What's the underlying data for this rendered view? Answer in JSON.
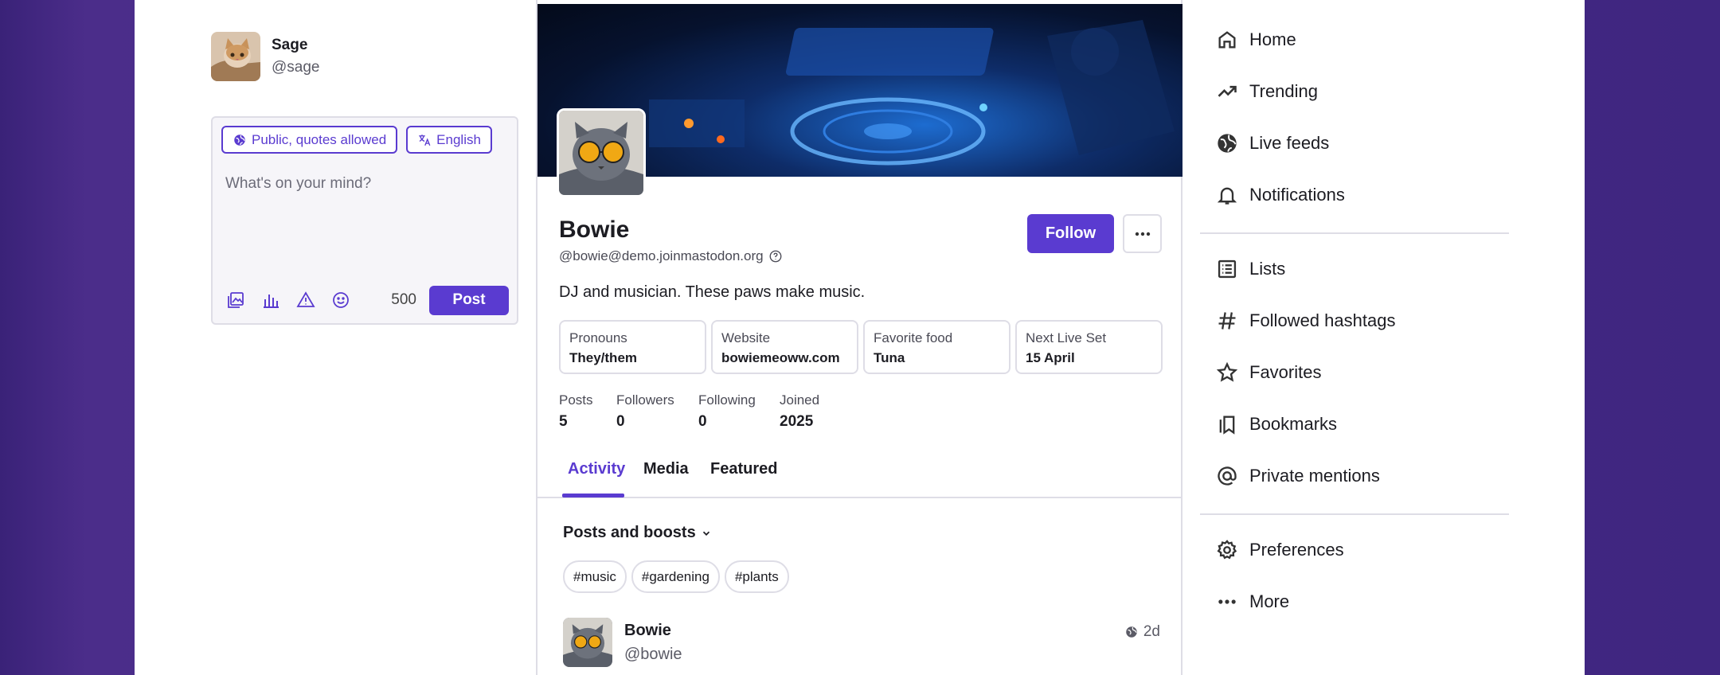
{
  "me": {
    "name": "Sage",
    "handle": "@sage"
  },
  "composer": {
    "visibility": "Public, quotes allowed",
    "language": "English",
    "placeholder": "What's on your mind?",
    "counter": "500",
    "post_label": "Post"
  },
  "profile": {
    "name": "Bowie",
    "acct": "@bowie@demo.joinmastodon.org",
    "follow_label": "Follow",
    "bio": "DJ and musician. These paws make music.",
    "fields": [
      {
        "name": "Pronouns",
        "value": "They/them"
      },
      {
        "name": "Website",
        "value": "bowiemeoww.com"
      },
      {
        "name": "Favorite food",
        "value": "Tuna"
      },
      {
        "name": "Next Live Set",
        "value": "15 April"
      }
    ],
    "stats": [
      {
        "label": "Posts",
        "value": "5"
      },
      {
        "label": "Followers",
        "value": "0"
      },
      {
        "label": "Following",
        "value": "0"
      },
      {
        "label": "Joined",
        "value": "2025"
      }
    ],
    "tabs": [
      "Activity",
      "Media",
      "Featured"
    ],
    "filter_label": "Posts and boosts",
    "hashtags": [
      "#music",
      "#gardening",
      "#plants"
    ],
    "status": {
      "name": "Bowie",
      "handle": "@bowie",
      "time": "2d"
    }
  },
  "nav": {
    "items": [
      {
        "label": "Home",
        "icon": "home-icon"
      },
      {
        "label": "Trending",
        "icon": "trending-icon"
      },
      {
        "label": "Live feeds",
        "icon": "globe-icon"
      },
      {
        "label": "Notifications",
        "icon": "bell-icon"
      },
      {
        "label": "Lists",
        "icon": "list-icon"
      },
      {
        "label": "Followed hashtags",
        "icon": "hashtag-icon"
      },
      {
        "label": "Favorites",
        "icon": "star-icon"
      },
      {
        "label": "Bookmarks",
        "icon": "bookmark-icon"
      },
      {
        "label": "Private mentions",
        "icon": "at-icon"
      },
      {
        "label": "Preferences",
        "icon": "gear-icon"
      },
      {
        "label": "More",
        "icon": "more-icon"
      }
    ]
  },
  "colors": {
    "accent": "#5a3bd0",
    "border": "#dedde6",
    "background": "#3f2680"
  }
}
